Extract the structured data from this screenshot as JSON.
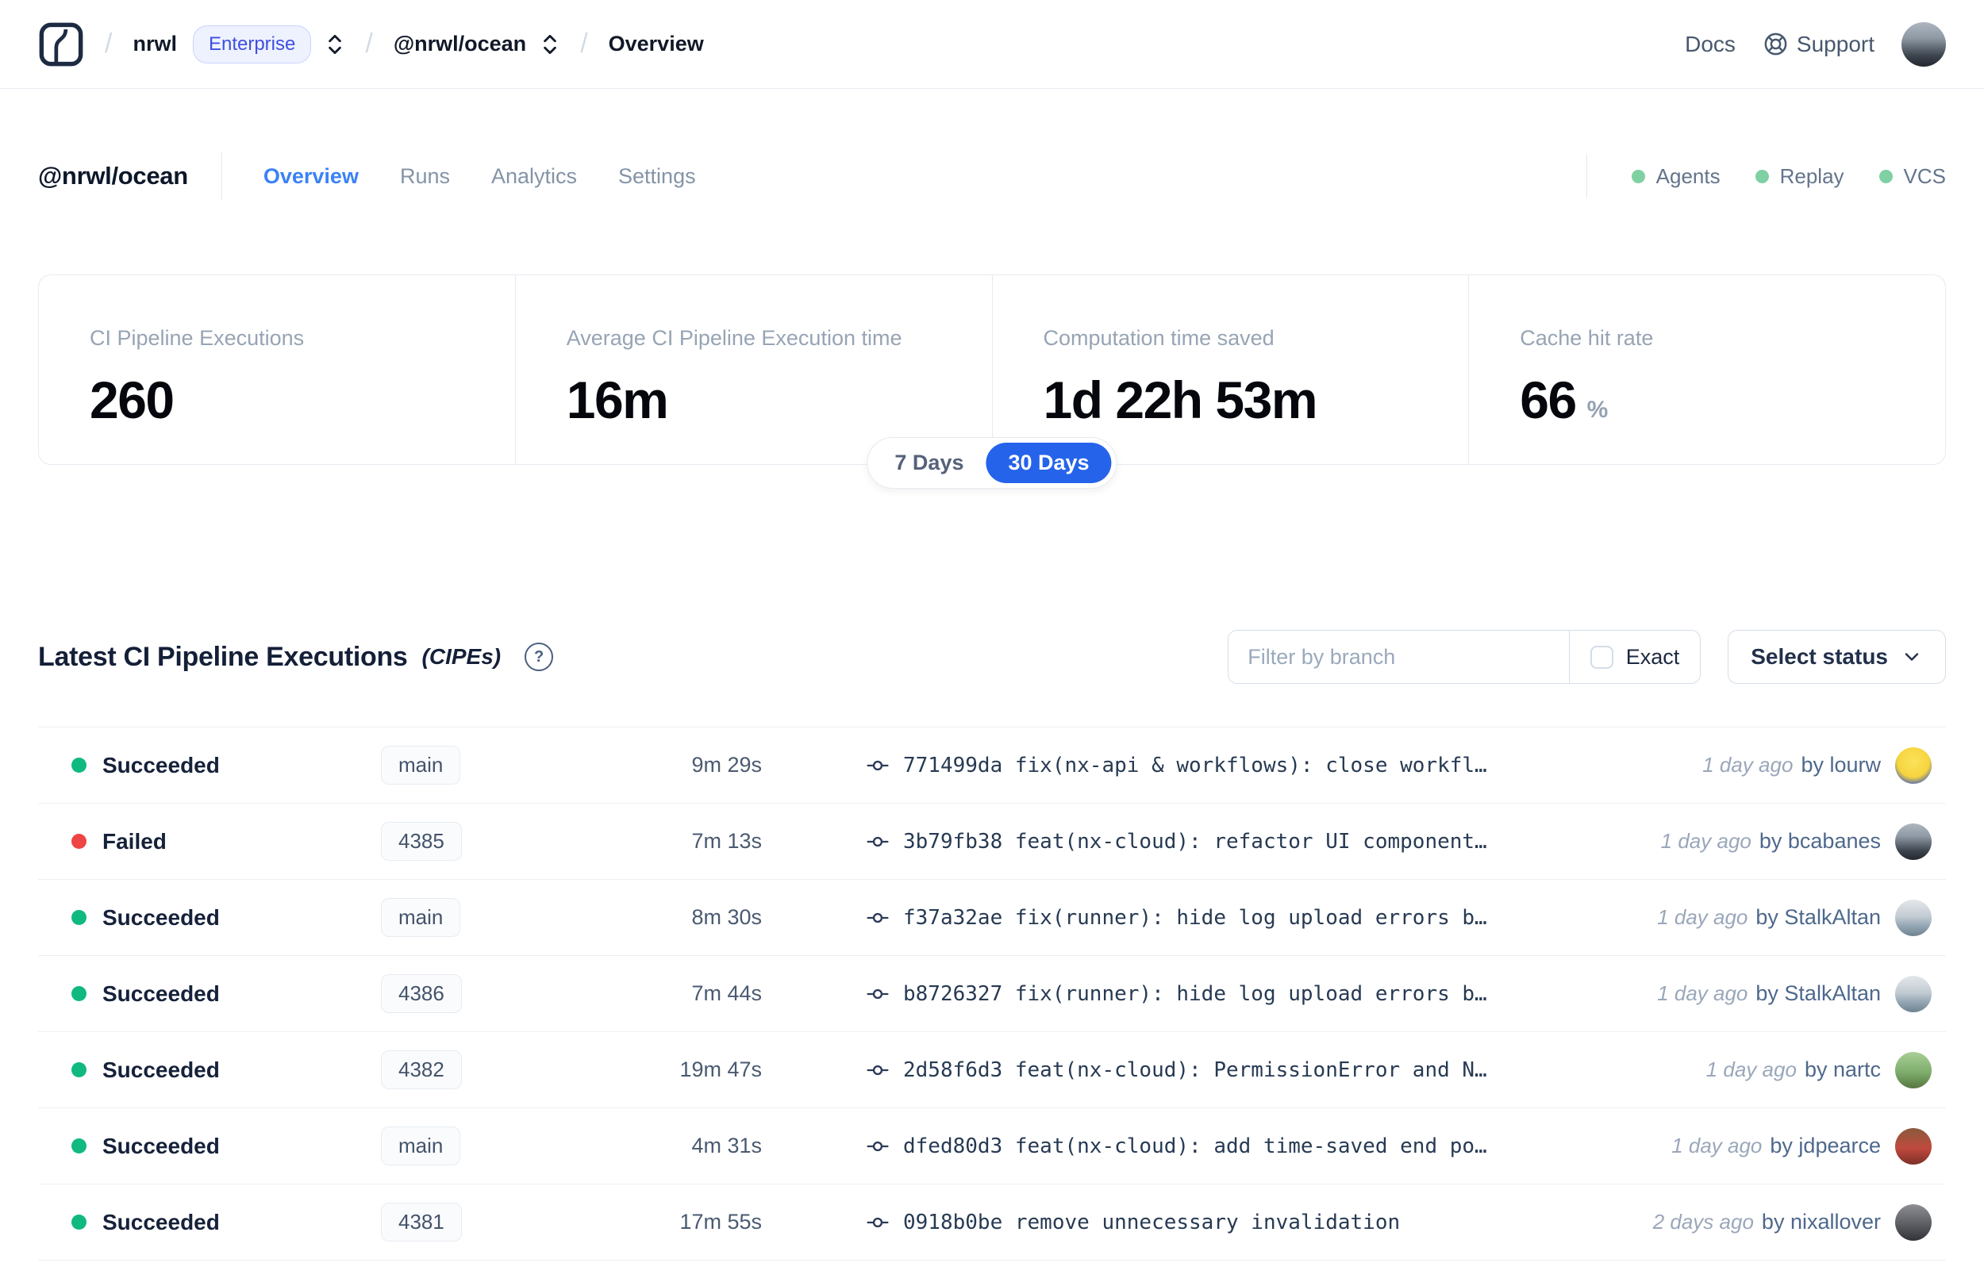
{
  "colors": {
    "accent": "#2563eb",
    "accent_tab": "#3b82f6",
    "success": "#10b981",
    "failed": "#ef4444",
    "status_green": "#7fd0a2"
  },
  "nav": {
    "breadcrumb": {
      "org": "nrwl",
      "org_badge": "Enterprise",
      "workspace": "@nrwl/ocean",
      "page": "Overview"
    },
    "docs_label": "Docs",
    "support_label": "Support"
  },
  "header": {
    "title": "@nrwl/ocean",
    "tabs": [
      {
        "label": "Overview",
        "active": true
      },
      {
        "label": "Runs",
        "active": false
      },
      {
        "label": "Analytics",
        "active": false
      },
      {
        "label": "Settings",
        "active": false
      }
    ],
    "statuses": [
      {
        "label": "Agents"
      },
      {
        "label": "Replay"
      },
      {
        "label": "VCS"
      }
    ]
  },
  "stats": {
    "cards": [
      {
        "label": "CI Pipeline Executions",
        "value": "260"
      },
      {
        "label": "Average CI Pipeline Execution time",
        "value": "16m"
      },
      {
        "label": "Computation time saved",
        "value": "1d 22h 53m"
      },
      {
        "label": "Cache hit rate",
        "value": "66",
        "unit": "%"
      }
    ],
    "range_toggle": {
      "options": [
        "7 Days",
        "30 Days"
      ],
      "selected": "30 Days"
    }
  },
  "section": {
    "title": "Latest CI Pipeline Executions",
    "title_suffix": "(CIPEs)",
    "help_glyph": "?",
    "filter_placeholder": "Filter by branch",
    "exact_label": "Exact",
    "status_select_label": "Select status"
  },
  "table": {
    "rows": [
      {
        "status": "Succeeded",
        "status_color": "green",
        "branch": "main",
        "duration": "9m 29s",
        "commit": "771499da fix(nx-api & workflows): close workfl…",
        "time": "1 day ago",
        "author": "by lourw",
        "avatar": "lourw"
      },
      {
        "status": "Failed",
        "status_color": "red",
        "branch": "4385",
        "duration": "7m 13s",
        "commit": "3b79fb38 feat(nx-cloud): refactor UI component…",
        "time": "1 day ago",
        "author": "by bcabanes",
        "avatar": "bcabanes"
      },
      {
        "status": "Succeeded",
        "status_color": "green",
        "branch": "main",
        "duration": "8m 30s",
        "commit": "f37a32ae fix(runner): hide log upload errors b…",
        "time": "1 day ago",
        "author": "by StalkAltan",
        "avatar": "stalkaltan"
      },
      {
        "status": "Succeeded",
        "status_color": "green",
        "branch": "4386",
        "duration": "7m 44s",
        "commit": "b8726327 fix(runner): hide log upload errors b…",
        "time": "1 day ago",
        "author": "by StalkAltan",
        "avatar": "stalkaltan"
      },
      {
        "status": "Succeeded",
        "status_color": "green",
        "branch": "4382",
        "duration": "19m 47s",
        "commit": "2d58f6d3 feat(nx-cloud): PermissionError and N…",
        "time": "1 day ago",
        "author": "by nartc",
        "avatar": "nartc"
      },
      {
        "status": "Succeeded",
        "status_color": "green",
        "branch": "main",
        "duration": "4m 31s",
        "commit": "dfed80d3 feat(nx-cloud): add time-saved end po…",
        "time": "1 day ago",
        "author": "by jdpearce",
        "avatar": "jdpearce"
      },
      {
        "status": "Succeeded",
        "status_color": "green",
        "branch": "4381",
        "duration": "17m 55s",
        "commit": "0918b0be remove unnecessary invalidation",
        "time": "2 days ago",
        "author": "by nixallover",
        "avatar": "nixallover"
      }
    ]
  }
}
